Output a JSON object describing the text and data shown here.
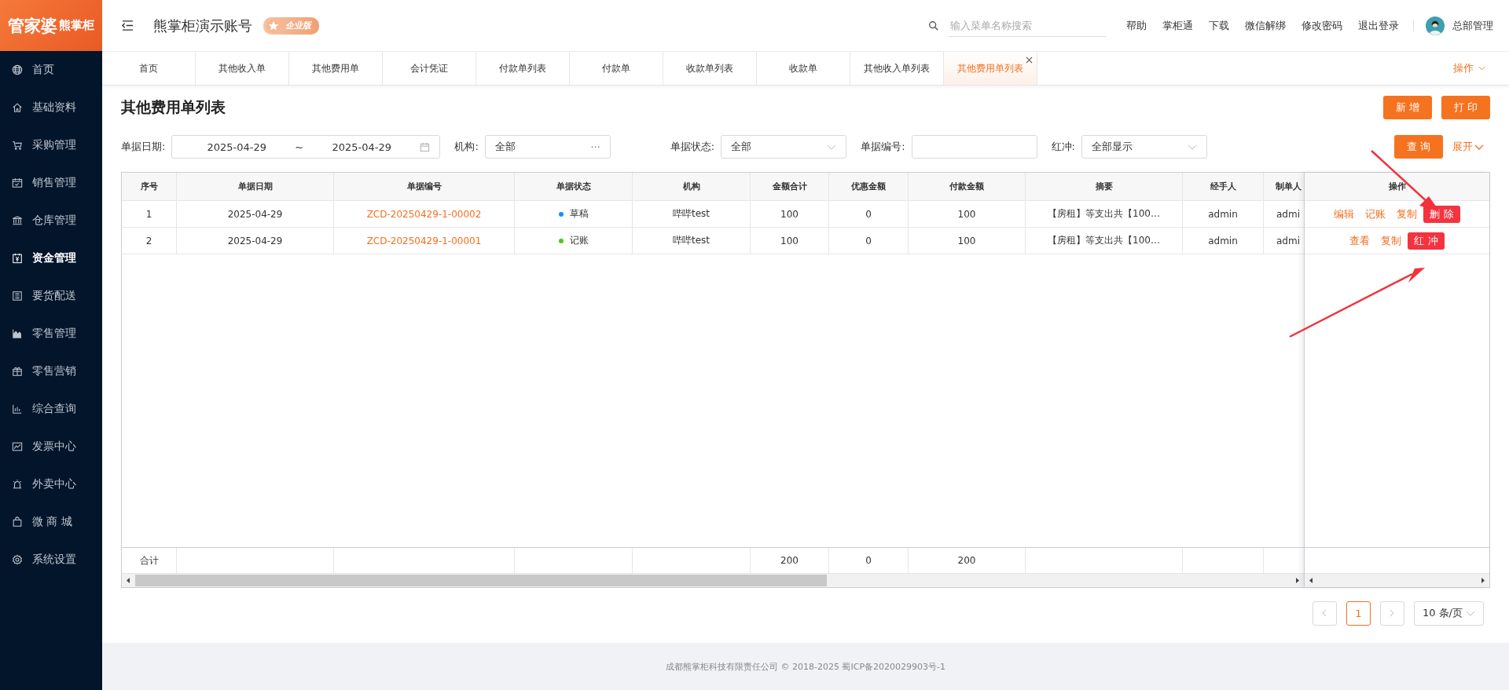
{
  "logo": {
    "main": "管家婆",
    "sub": "熊掌柜"
  },
  "sidebar": {
    "items": [
      {
        "label": "首页",
        "selected": false
      },
      {
        "label": "基础资料",
        "selected": false
      },
      {
        "label": "采购管理",
        "selected": false
      },
      {
        "label": "销售管理",
        "selected": false
      },
      {
        "label": "仓库管理",
        "selected": false
      },
      {
        "label": "资金管理",
        "selected": true
      },
      {
        "label": "要货配送",
        "selected": false
      },
      {
        "label": "零售管理",
        "selected": false
      },
      {
        "label": "零售营销",
        "selected": false
      },
      {
        "label": "综合查询",
        "selected": false
      },
      {
        "label": "发票中心",
        "selected": false
      },
      {
        "label": "外卖中心",
        "selected": false
      },
      {
        "label": "微 商 城",
        "selected": false
      },
      {
        "label": "系统设置",
        "selected": false
      }
    ]
  },
  "header": {
    "account": "熊掌柜演示账号",
    "edition": "企业版",
    "search": {
      "placeholder": "输入菜单名称搜索"
    },
    "links": [
      "帮助",
      "掌柜通",
      "下载",
      "微信解绑",
      "修改密码",
      "退出登录"
    ],
    "user": "总部管理"
  },
  "tabs": [
    {
      "label": "首页",
      "selected": false
    },
    {
      "label": "其他收入单",
      "selected": false
    },
    {
      "label": "其他费用单",
      "selected": false
    },
    {
      "label": "会计凭证",
      "selected": false
    },
    {
      "label": "付款单列表",
      "selected": false
    },
    {
      "label": "付款单",
      "selected": false
    },
    {
      "label": "收款单列表",
      "selected": false
    },
    {
      "label": "收款单",
      "selected": false
    },
    {
      "label": "其他收入单列表",
      "selected": false
    },
    {
      "label": "其他费用单列表",
      "selected": true,
      "closable": true
    }
  ],
  "tabs_menu": "操作",
  "page": {
    "title": "其他费用单列表",
    "buttons": [
      "新 增",
      "打 印"
    ]
  },
  "filters": {
    "date_label": "单据日期:",
    "date_from": "2025-04-29",
    "date_sep": "~",
    "date_to": "2025-04-29",
    "org_label": "机构:",
    "org_value": "全部",
    "org_more": "···",
    "status_label": "单据状态:",
    "status_value": "全部",
    "number_label": "单据编号:",
    "red_label": "红冲:",
    "red_value": "全部显示",
    "query": "查 询",
    "expand": "展开"
  },
  "table": {
    "columns": [
      "序号",
      "单据日期",
      "单据编号",
      "单据状态",
      "机构",
      "金额合计",
      "优惠金额",
      "付款金额",
      "摘要",
      "经手人",
      "制单人"
    ],
    "action_column": "操作",
    "rows": [
      {
        "cells": [
          "1",
          "2025-04-29",
          "ZCD-20250429-1-00002",
          "草稿",
          "哔哔test",
          "100",
          "0",
          "100",
          "【房租】等支出共【100…",
          "admin",
          "admi"
        ],
        "color": "#1890ff",
        "actions": [
          {
            "label": "编辑",
            "kind": "link"
          },
          {
            "label": "记账",
            "kind": "link"
          },
          {
            "label": "复制",
            "kind": "link"
          },
          {
            "label": "删 除",
            "kind": "danger"
          }
        ]
      },
      {
        "cells": [
          "2",
          "2025-04-29",
          "ZCD-20250429-1-00001",
          "记账",
          "哔哔test",
          "100",
          "0",
          "100",
          "【房租】等支出共【100…",
          "admin",
          "admi"
        ],
        "color": "#52c41a",
        "actions": [
          {
            "label": "查看",
            "kind": "link"
          },
          {
            "label": "复制",
            "kind": "link"
          },
          {
            "label": "红 冲",
            "kind": "danger"
          }
        ]
      }
    ],
    "totals": {
      "label": "合计",
      "amount": "200",
      "discount": "0",
      "paid": "200"
    }
  },
  "pagination": {
    "page": "1",
    "size": "10 条/页"
  },
  "footer": "成都熊掌柜科技有限责任公司 © 2018-2025 蜀ICP备2020029903号-1"
}
